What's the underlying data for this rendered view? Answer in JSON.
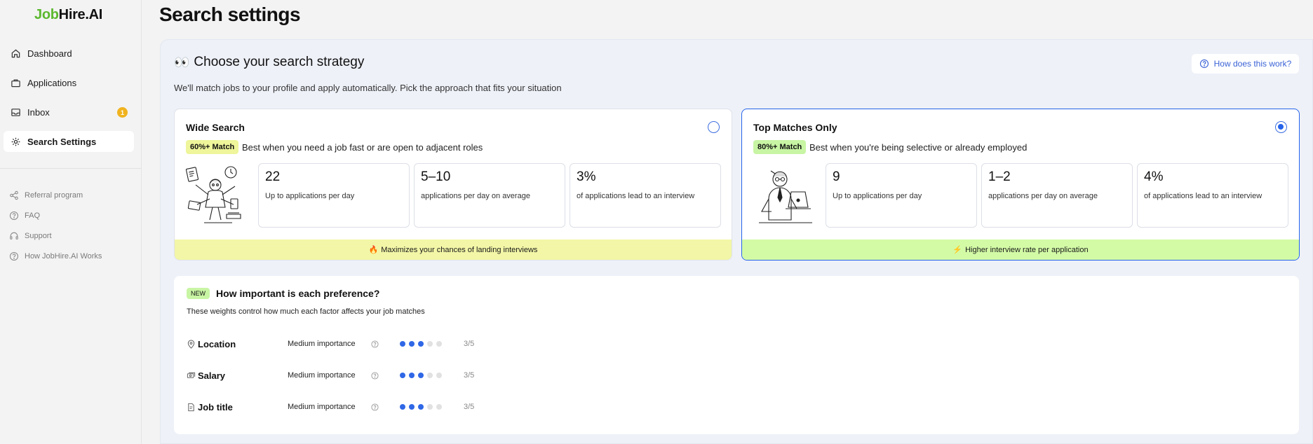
{
  "app": {
    "logo_part1": "Job",
    "logo_part2": "Hire.AI",
    "brand_color": "#5bb82e",
    "accent_color": "#2563eb"
  },
  "sidebar": {
    "items": [
      {
        "label": "Dashboard",
        "icon": "home-icon"
      },
      {
        "label": "Applications",
        "icon": "briefcase-icon"
      },
      {
        "label": "Inbox",
        "icon": "inbox-icon",
        "badge": "1"
      },
      {
        "label": "Search Settings",
        "icon": "gear-icon",
        "active": true
      }
    ],
    "secondary": [
      {
        "label": "Referral program",
        "icon": "share-icon"
      },
      {
        "label": "FAQ",
        "icon": "question-icon"
      },
      {
        "label": "Support",
        "icon": "headset-icon"
      },
      {
        "label": "How JobHire.AI Works",
        "icon": "question-icon"
      }
    ]
  },
  "page": {
    "title": "Search settings"
  },
  "strategy": {
    "emoji": "👀",
    "title": "Choose your search strategy",
    "subtitle": "We'll match jobs to your profile and apply automatically. Pick the approach that fits your situation",
    "help_label": "How does this work?",
    "cards": [
      {
        "title": "Wide Search",
        "selected": false,
        "match_tag": "60%+ Match",
        "description": "Best when you need a job fast or are open to adjacent roles",
        "stats": [
          {
            "value": "22",
            "label": "Up to applications per day"
          },
          {
            "value": "5–10",
            "label": "applications per day on average"
          },
          {
            "value": "3%",
            "label": "of applications lead to an interview"
          }
        ],
        "footer_emoji": "🔥",
        "footer": "Maximizes your chances of landing interviews"
      },
      {
        "title": "Top Matches Only",
        "selected": true,
        "match_tag": "80%+ Match",
        "description": "Best when you're being selective or already employed",
        "stats": [
          {
            "value": "9",
            "label": "Up to applications per day"
          },
          {
            "value": "1–2",
            "label": "applications per day on average"
          },
          {
            "value": "4%",
            "label": "of applications lead to an interview"
          }
        ],
        "footer_emoji": "⚡",
        "footer": "Higher interview rate per application"
      }
    ]
  },
  "preferences": {
    "new_tag": "NEW",
    "title": "How important is each preference?",
    "subtitle": "These weights control how much each factor affects your job matches",
    "rows": [
      {
        "name": "Location",
        "icon": "location-pin-icon",
        "level": "Medium importance",
        "score": "3/5",
        "value": 3
      },
      {
        "name": "Salary",
        "icon": "money-icon",
        "level": "Medium importance",
        "score": "3/5",
        "value": 3
      },
      {
        "name": "Job title",
        "icon": "document-icon",
        "level": "Medium importance",
        "score": "3/5",
        "value": 3
      }
    ]
  }
}
